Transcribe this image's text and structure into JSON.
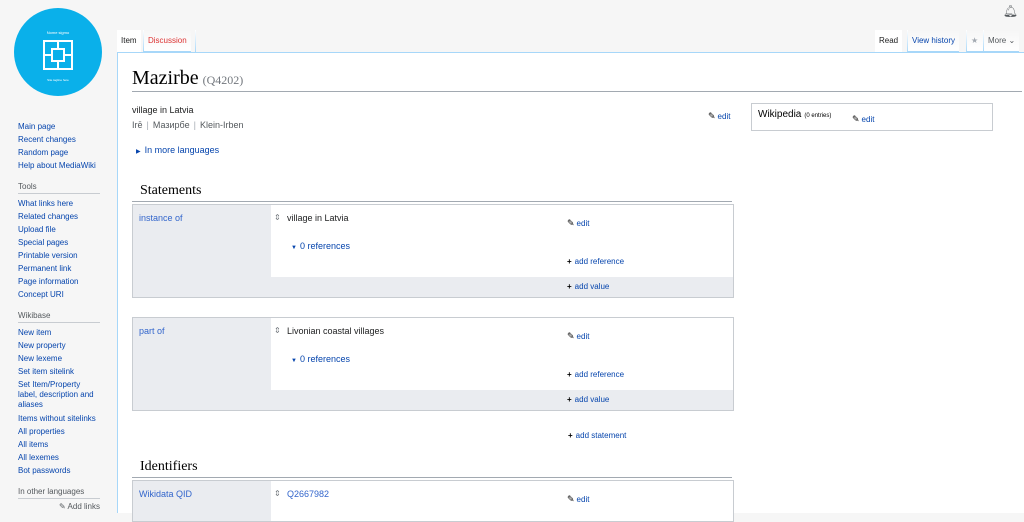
{
  "logo": {
    "text_top": "Nome sigmo",
    "text_bottom": "Site tagline here"
  },
  "sidebar": {
    "nav": [
      "Main page",
      "Recent changes",
      "Random page",
      "Help about MediaWiki"
    ],
    "tools_heading": "Tools",
    "tools": [
      "What links here",
      "Related changes",
      "Upload file",
      "Special pages",
      "Printable version",
      "Permanent link",
      "Page information",
      "Concept URI"
    ],
    "wikibase_heading": "Wikibase",
    "wikibase": [
      "New item",
      "New property",
      "New lexeme",
      "Set item sitelink",
      "Set Item/Property label, description and aliases",
      "Items without sitelinks",
      "All properties",
      "All items",
      "All lexemes",
      "Bot passwords"
    ],
    "languages_heading": "In other languages",
    "add_links": "Add links"
  },
  "tabs": {
    "item": "Item",
    "discussion": "Discussion",
    "read": "Read",
    "view_history": "View history",
    "more": "More"
  },
  "page": {
    "title": "Mazirbe",
    "qid": "(Q4202)",
    "description": "village in Latvia",
    "aliases": [
      "Irē",
      "Мазирбе",
      "Klein-Irben"
    ],
    "edit": "edit",
    "more_languages": "In more languages"
  },
  "sitelinks": {
    "title": "Wikipedia",
    "count": "(0 entries)",
    "edit": "edit"
  },
  "statements": {
    "heading": "Statements",
    "items": [
      {
        "property": "instance of",
        "value": "village in Latvia",
        "references": "0 references",
        "edit": "edit",
        "add_reference": "add reference",
        "add_value": "add value"
      },
      {
        "property": "part of",
        "value": "Livonian coastal villages",
        "references": "0 references",
        "edit": "edit",
        "add_reference": "add reference",
        "add_value": "add value"
      }
    ],
    "add_statement": "add statement"
  },
  "identifiers": {
    "heading": "Identifiers",
    "items": [
      {
        "property": "Wikidata QID",
        "value": "Q2667982",
        "edit": "edit"
      }
    ]
  }
}
